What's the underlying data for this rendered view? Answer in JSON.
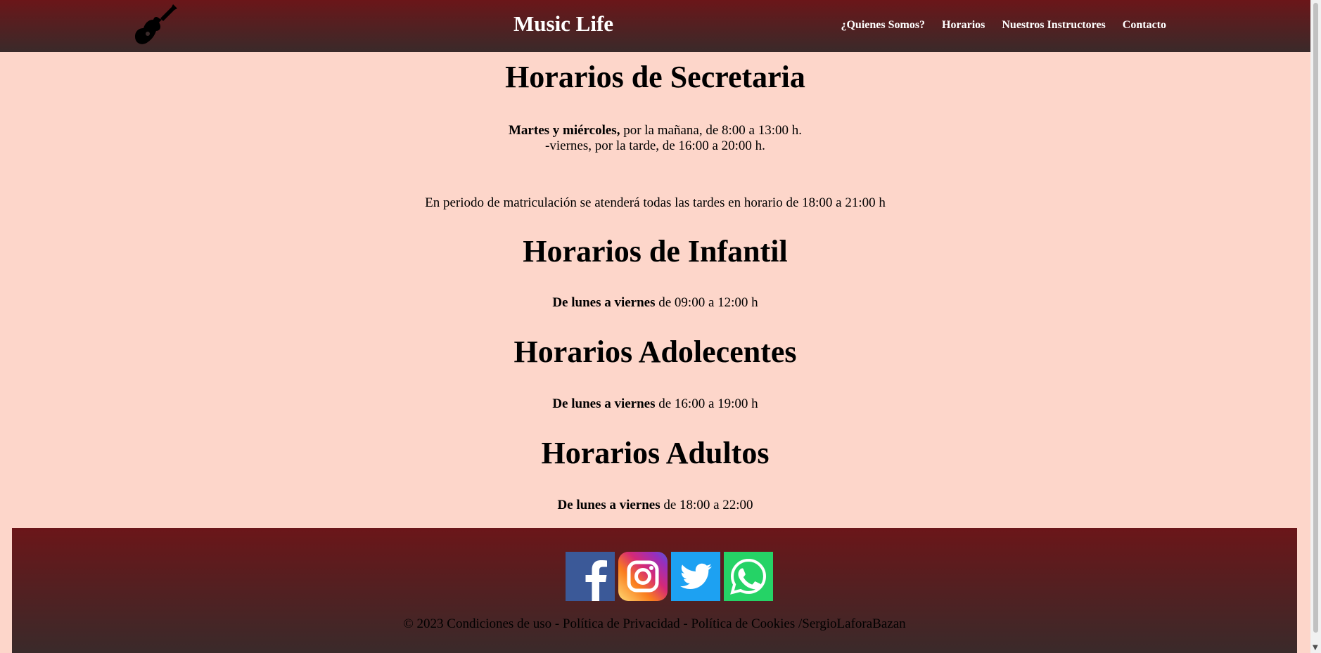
{
  "header": {
    "logo_icon": "guitar-icon",
    "title": "Music Life",
    "nav": [
      {
        "label": "¿Quienes Somos?"
      },
      {
        "label": "Horarios"
      },
      {
        "label": "Nuestros Instructores"
      },
      {
        "label": "Contacto"
      }
    ]
  },
  "sections": {
    "secretaria": {
      "title": "Horarios de Secretaria",
      "line1_bold": "Martes y miércoles,",
      "line1_rest": " por la mañana, de 8:00 a 13:00 h.",
      "line2": "-viernes, por la tarde, de 16:00 a 20:00 h.",
      "note": "En periodo de matriculación se atenderá todas las tardes en horario de 18:00 a 21:00 h"
    },
    "infantil": {
      "title": "Horarios de Infantil",
      "bold": "De lunes a viernes",
      "rest": " de 09:00 a 12:00 h"
    },
    "adolecentes": {
      "title": "Horarios Adolecentes",
      "bold": "De lunes a viernes",
      "rest": " de 16:00 a 19:00 h"
    },
    "adultos": {
      "title": "Horarios Adultos",
      "bold": "De lunes a viernes",
      "rest": " de 18:00 a 22:00"
    }
  },
  "footer": {
    "socials": [
      {
        "icon": "facebook-icon",
        "color": "#3b5998"
      },
      {
        "icon": "instagram-icon",
        "color": "#c13584"
      },
      {
        "icon": "twitter-icon",
        "color": "#1da1f2"
      },
      {
        "icon": "whatsapp-icon",
        "color": "#25d366"
      }
    ],
    "copyright": "© 2023 Condiciones de uso - Política de Privacidad - Política de Cookies /SergioLaforaBazan"
  }
}
